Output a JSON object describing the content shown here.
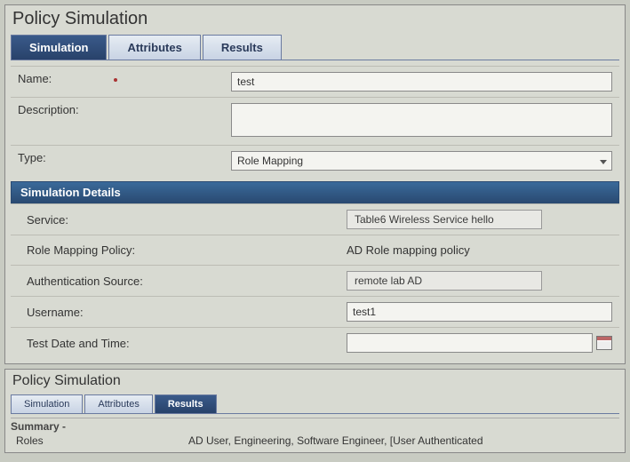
{
  "top": {
    "title": "Policy Simulation",
    "tabs": {
      "simulation": "Simulation",
      "attributes": "Attributes",
      "results": "Results",
      "active": "simulation"
    },
    "form": {
      "name_label": "Name:",
      "name_value": "test",
      "description_label": "Description:",
      "description_value": "",
      "type_label": "Type:",
      "type_value": "Role Mapping"
    },
    "details_header": "Simulation Details",
    "details": {
      "service_label": "Service:",
      "service_value": "Table6 Wireless Service hello",
      "rmp_label": "Role Mapping Policy:",
      "rmp_value": "AD Role mapping policy",
      "auth_src_label": "Authentication Source:",
      "auth_src_value": "remote lab AD",
      "username_label": "Username:",
      "username_value": "test1",
      "testdate_label": "Test Date and Time:",
      "testdate_value": ""
    }
  },
  "bottom": {
    "title": "Policy Simulation",
    "tabs": {
      "simulation": "Simulation",
      "attributes": "Attributes",
      "results": "Results",
      "active": "results"
    },
    "summary_label": "Summary -",
    "roles_label": "Roles",
    "roles_value": "AD User, Engineering, Software Engineer, [User Authenticated"
  }
}
